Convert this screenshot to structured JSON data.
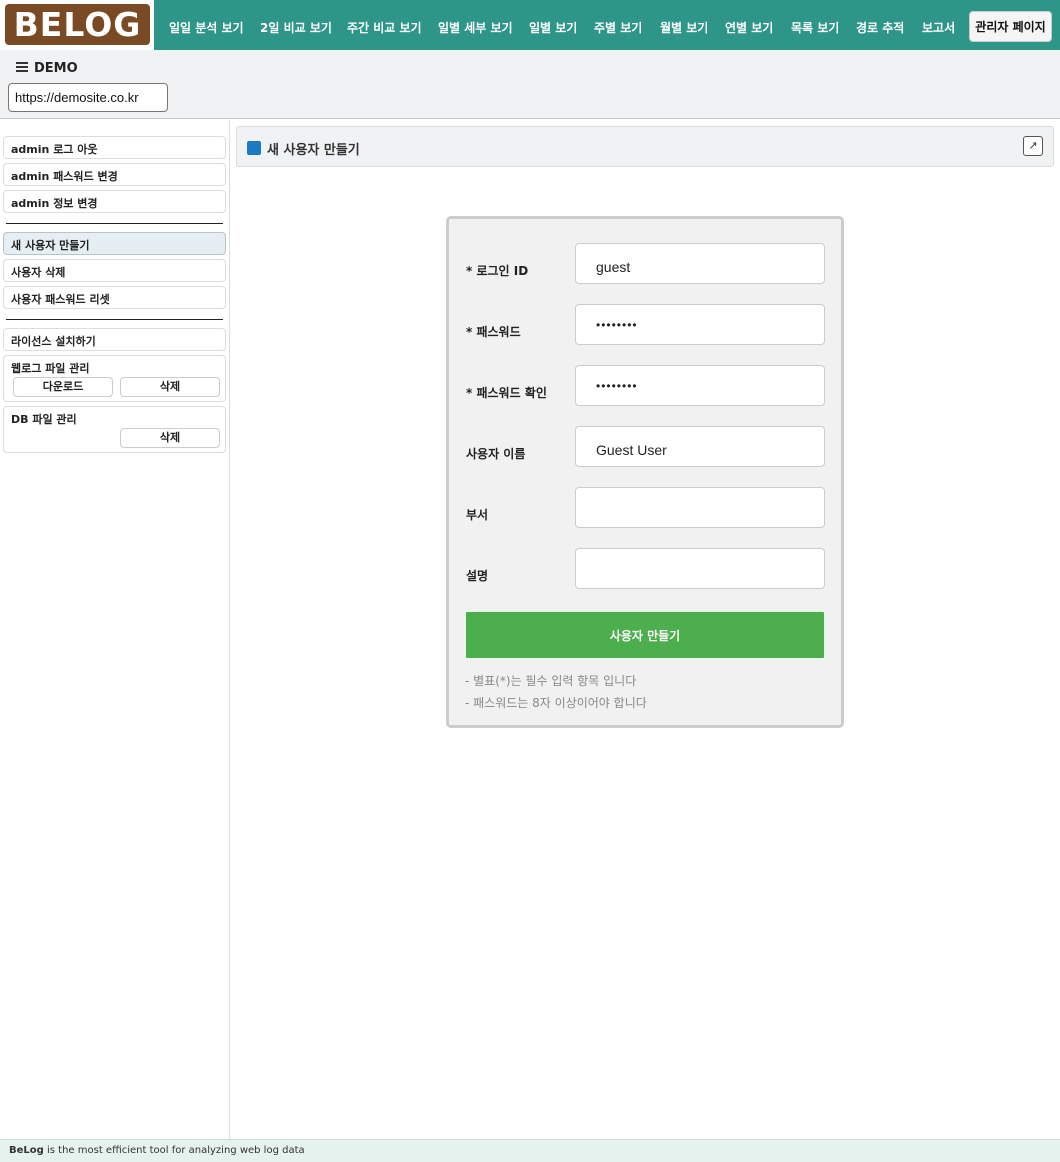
{
  "brand": {
    "logo": "BELOG"
  },
  "nav": {
    "items": [
      {
        "label": "일일 분석 보기"
      },
      {
        "label": "2일 비교 보기"
      },
      {
        "label": "주간 비교 보기"
      },
      {
        "label": "일별 세부 보기"
      },
      {
        "label": "일별 보기"
      },
      {
        "label": "주별 보기"
      },
      {
        "label": "월별 보기"
      },
      {
        "label": "연별 보기"
      },
      {
        "label": "목록 보기"
      },
      {
        "label": "경로 추적"
      },
      {
        "label": "보고서"
      }
    ],
    "admin_label": "관리자 페이지"
  },
  "site": {
    "name": "DEMO",
    "url": "https://demosite.co.kr"
  },
  "sidebar": {
    "account": [
      "admin 로그 아웃",
      "admin 패스워드 변경",
      "admin 정보 변경"
    ],
    "users": [
      "새 사용자 만들기",
      "사용자 삭제",
      "사용자 패스워드 리셋"
    ],
    "license": "라이선스 설치하기",
    "weblog_panel": {
      "title": "웹로그 파일 관리",
      "download": "다운로드",
      "delete": "삭제"
    },
    "db_panel": {
      "title": "DB 파일 관리",
      "delete": "삭제"
    }
  },
  "main": {
    "title": "새 사용자 만들기",
    "expand_icon": "↗"
  },
  "form": {
    "fields": [
      {
        "label": "* 로그인 ID",
        "value": "guest"
      },
      {
        "label": "* 패스워드",
        "value": "••••••••"
      },
      {
        "label": "* 패스워드 확인",
        "value": "••••••••"
      },
      {
        "label": "사용자 이름",
        "value": "Guest User"
      },
      {
        "label": "부서",
        "value": ""
      },
      {
        "label": "설명",
        "value": ""
      }
    ],
    "submit_label": "사용자 만들기",
    "notes": [
      "- 별표(*)는 필수 입력 항목 입니다",
      "- 패스워드는 8자 이상이어야 합니다"
    ]
  },
  "footer": {
    "brand": "BeLog",
    "text": " is the most efficient tool for analyzing web log data"
  },
  "colors": {
    "nav_bg": "#2e9688",
    "logo_bg": "#7a4a25",
    "submit_bg": "#4cae4c",
    "title_square": "#1a7ac4"
  }
}
